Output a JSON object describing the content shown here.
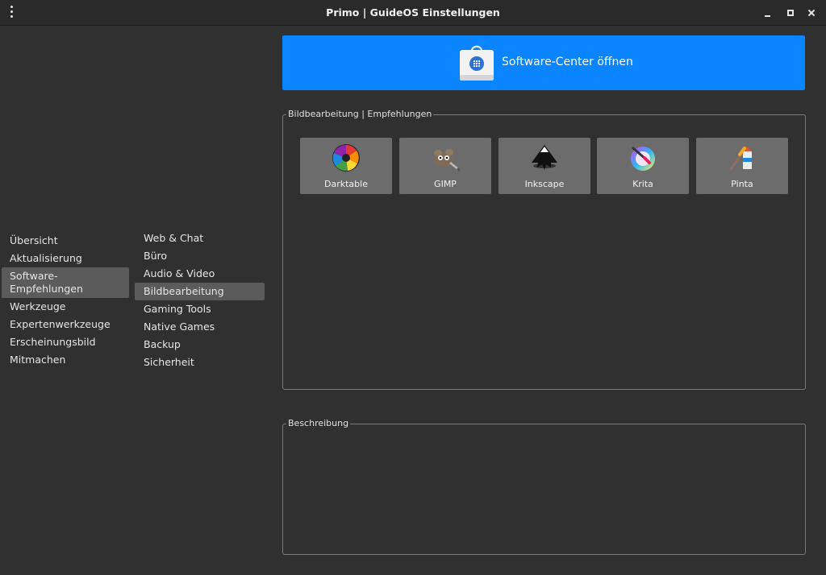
{
  "window": {
    "title": "Primo | GuideOS Einstellungen"
  },
  "nav_main": {
    "items": [
      {
        "label": "Übersicht"
      },
      {
        "label": "Aktualisierung"
      },
      {
        "label": "Software-\nEmpfehlungen",
        "selected": true
      },
      {
        "label": "Werkzeuge"
      },
      {
        "label": "Expertenwerkzeuge"
      },
      {
        "label": "Erscheinungsbild"
      },
      {
        "label": "Mitmachen"
      }
    ]
  },
  "nav_sub": {
    "items": [
      {
        "label": "Web & Chat"
      },
      {
        "label": "Büro"
      },
      {
        "label": "Audio & Video"
      },
      {
        "label": "Bildbearbeitung",
        "selected": true
      },
      {
        "label": "Gaming Tools"
      },
      {
        "label": "Native Games"
      },
      {
        "label": "Backup"
      },
      {
        "label": "Sicherheit"
      }
    ]
  },
  "software_center": {
    "label": "Software-Center öffnen",
    "icon": "shopping-bag-icon",
    "color": "#0a84ff"
  },
  "recommendations": {
    "legend": "Bildbearbeitung | Empfehlungen",
    "apps": [
      {
        "label": "Darktable",
        "icon": "darktable-icon"
      },
      {
        "label": "GIMP",
        "icon": "gimp-icon"
      },
      {
        "label": "Inkscape",
        "icon": "inkscape-icon"
      },
      {
        "label": "Krita",
        "icon": "krita-icon"
      },
      {
        "label": "Pinta",
        "icon": "pinta-icon"
      }
    ]
  },
  "description": {
    "legend": "Beschreibung",
    "text": ""
  }
}
